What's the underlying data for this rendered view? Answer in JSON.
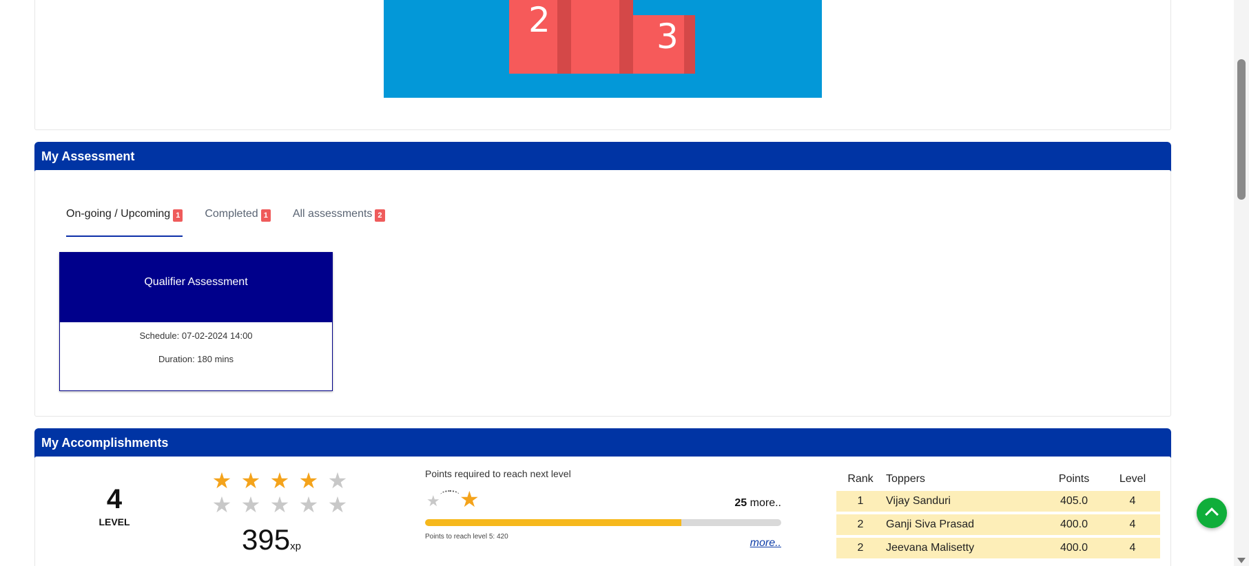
{
  "podium": {
    "second": "2",
    "third": "3"
  },
  "assessment": {
    "section_title": "My Assessment",
    "tabs": [
      {
        "label": "On-going / Upcoming",
        "count": "1",
        "active": true
      },
      {
        "label": "Completed",
        "count": "1",
        "active": false
      },
      {
        "label": "All assessments",
        "count": "2",
        "active": false
      }
    ],
    "card": {
      "title": "Qualifier Assessment",
      "schedule": "Schedule: 07-02-2024 14:00",
      "duration": "Duration: 180 mins"
    }
  },
  "accomplishments": {
    "section_title": "My Accomplishments",
    "level": "4",
    "level_label": "LEVEL",
    "stars_filled": 4,
    "stars_total": 5,
    "xp": "395",
    "xp_unit": "xp",
    "progress_title": "Points required to reach next level",
    "points_more": "25",
    "points_more_suffix": " more..",
    "progress_fraction": 0.72,
    "progress_note": "Points to reach level 5: 420",
    "more_link": "more..",
    "leaderboard": {
      "headers": [
        "Rank",
        "Toppers",
        "Points",
        "Level"
      ],
      "rows": [
        {
          "rank": "1",
          "name": "Vijay Sanduri",
          "points": "405.0",
          "level": "4"
        },
        {
          "rank": "2",
          "name": "Ganji Siva Prasad",
          "points": "400.0",
          "level": "4"
        },
        {
          "rank": "2",
          "name": "Jeevana Malisetty",
          "points": "400.0",
          "level": "4"
        }
      ]
    }
  },
  "colors": {
    "header_blue": "#0034a4",
    "card_navy": "#00008b",
    "badge_red": "#ef5b5b",
    "star_gold": "#f4a31b",
    "fab_green": "#0fae3a"
  },
  "icons": {
    "fab": "chevron-up-icon",
    "star": "star-icon"
  }
}
